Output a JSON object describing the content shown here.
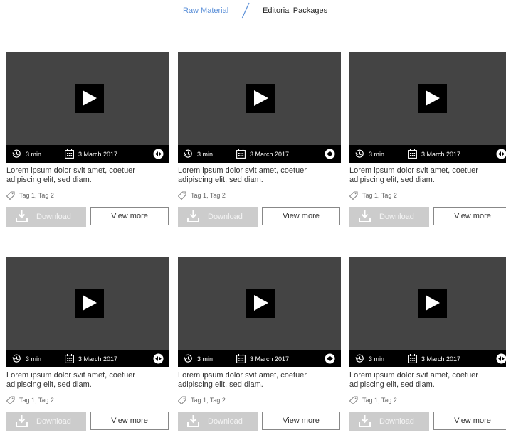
{
  "tabs": {
    "raw": "Raw Material",
    "editorial": "Editorial Packages",
    "active": "editorial"
  },
  "colors": {
    "tab_link": "#5a8fd8",
    "video_bg": "#444444",
    "download_bg": "#cccccc"
  },
  "cards": [
    {
      "duration": "3 min",
      "date": "3 March 2017",
      "title": "Lorem ipsum dolor svit amet, coetuer adipiscing elit, sed diam.",
      "tags": "Tag 1, Tag 2",
      "download": "Download",
      "view": "View more"
    },
    {
      "duration": "3 min",
      "date": "3 March 2017",
      "title": "Lorem ipsum dolor svit amet, coetuer adipiscing elit, sed diam.",
      "tags": "Tag 1, Tag 2",
      "download": "Download",
      "view": "View more"
    },
    {
      "duration": "3 min",
      "date": "3 March 2017",
      "title": "Lorem ipsum dolor svit amet, coetuer adipiscing elit, sed diam.",
      "tags": "Tag 1, Tag 2",
      "download": "Download",
      "view": "View more"
    },
    {
      "duration": "3 min",
      "date": "3 March 2017",
      "title": "Lorem ipsum dolor svit amet, coetuer adipiscing elit, sed diam.",
      "tags": "Tag 1, Tag 2",
      "download": "Download",
      "view": "View more"
    },
    {
      "duration": "3 min",
      "date": "3 March 2017",
      "title": "Lorem ipsum dolor svit amet, coetuer adipiscing elit, sed diam.",
      "tags": "Tag 1, Tag 2",
      "download": "Download",
      "view": "View more"
    },
    {
      "duration": "3 min",
      "date": "3 March 2017",
      "title": "Lorem ipsum dolor svit amet, coetuer adipiscing elit, sed diam.",
      "tags": "Tag 1, Tag 2",
      "download": "Download",
      "view": "View more"
    }
  ],
  "icons": [
    "clock-icon",
    "calendar-icon",
    "share-icon",
    "play-icon",
    "tag-icon",
    "download-icon"
  ]
}
